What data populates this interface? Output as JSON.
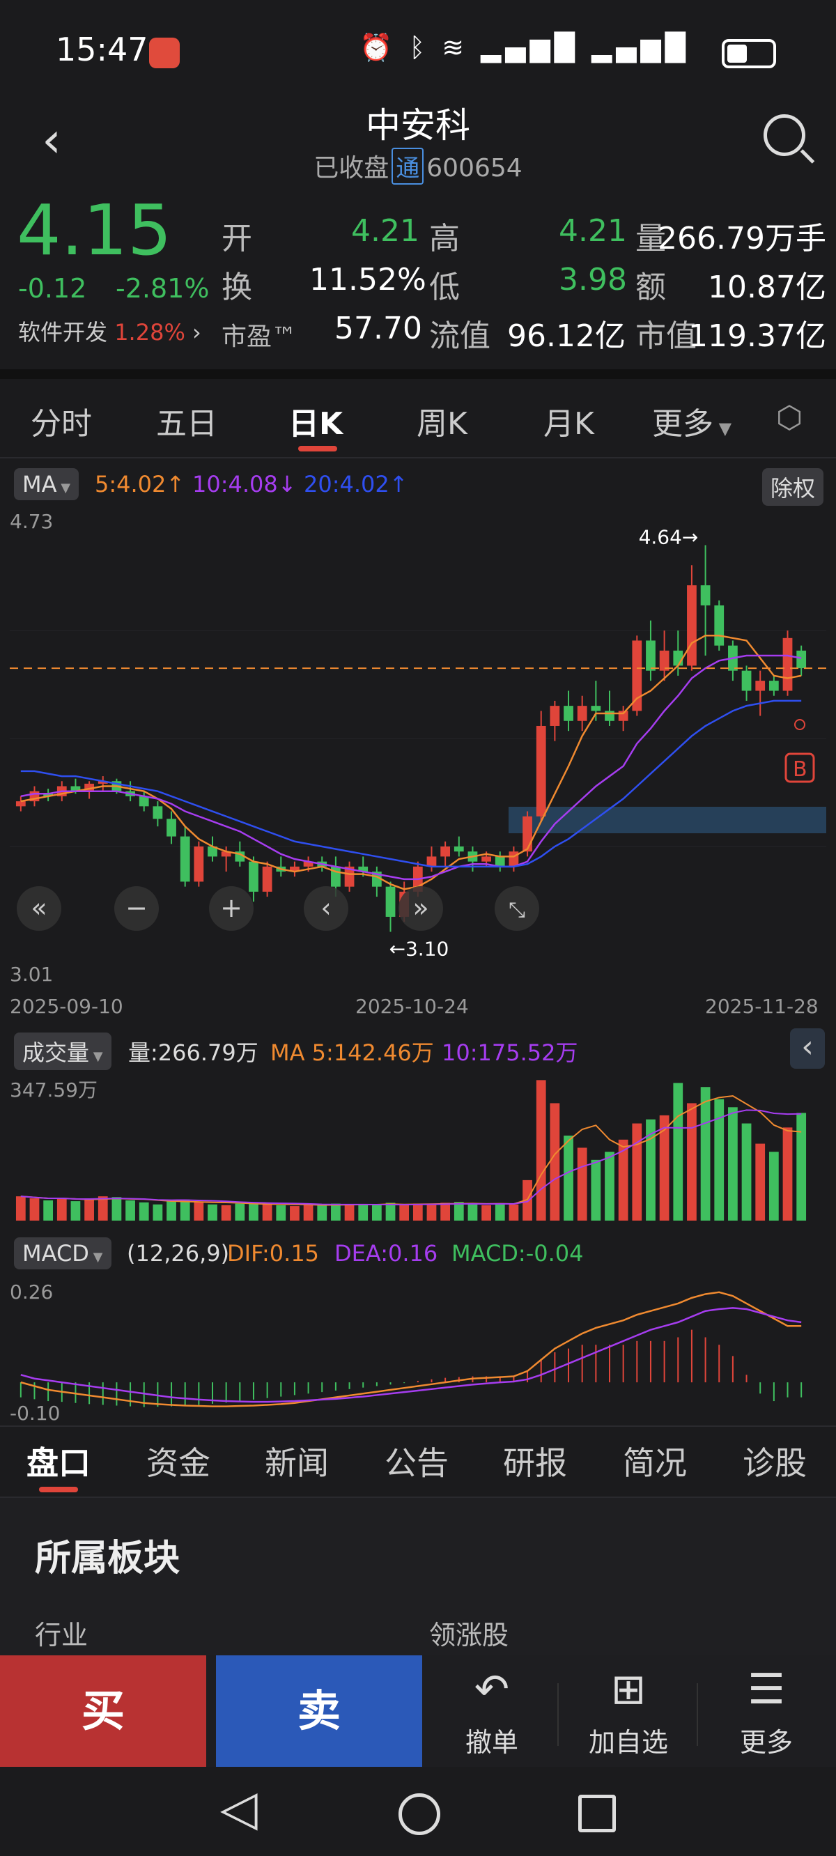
{
  "status": {
    "time": "15:47"
  },
  "header": {
    "title": "中安科",
    "status": "已收盘",
    "tong": "通",
    "code": "600654"
  },
  "quote": {
    "price": "4.15",
    "change": "-0.12",
    "change_pct": "-2.81%",
    "sector_name": "软件开发",
    "sector_pct": "1.28%",
    "open_label": "开",
    "open": "4.21",
    "high_label": "高",
    "high": "4.21",
    "volume_label": "量",
    "volume": "266.79万手",
    "turnover_label": "换",
    "turnover": "11.52%",
    "low_label": "低",
    "low": "3.98",
    "amount_label": "额",
    "amount": "10.87亿",
    "pe_label": "市盈™",
    "pe": "57.70",
    "float_label": "流值",
    "float_cap": "96.12亿",
    "mcap_label": "市值",
    "mcap": "119.37亿"
  },
  "tabs": [
    "分时",
    "五日",
    "日K",
    "周K",
    "月K",
    "更多"
  ],
  "ma_bar": {
    "ma_label": "MA",
    "ma5": "5:4.02↑",
    "ma10": "10:4.08↓",
    "ma20": "20:4.02↑",
    "adjust": "除权"
  },
  "colors": {
    "up": "#e0453a",
    "down": "#3fbf5f",
    "ma5": "#f08a30",
    "ma10": "#a63df0",
    "ma20": "#2f4ff0"
  },
  "chart_data": [
    {
      "type": "candlestick",
      "title": "日K",
      "y_top_label": "4.73",
      "y_bottom_label": "3.01",
      "ylim": [
        3.01,
        4.73
      ],
      "x_labels": [
        "2025-09-10",
        "2025-10-24",
        "2025-11-28"
      ],
      "max_marker": "4.64→",
      "min_marker": "←3.10",
      "current_price_line": 4.15,
      "candles": [
        [
          3.6,
          3.64,
          3.58,
          3.62
        ],
        [
          3.62,
          3.68,
          3.6,
          3.66
        ],
        [
          3.65,
          3.67,
          3.62,
          3.64
        ],
        [
          3.64,
          3.7,
          3.62,
          3.68
        ],
        [
          3.68,
          3.71,
          3.65,
          3.66
        ],
        [
          3.66,
          3.7,
          3.63,
          3.69
        ],
        [
          3.69,
          3.72,
          3.66,
          3.7
        ],
        [
          3.7,
          3.71,
          3.65,
          3.66
        ],
        [
          3.66,
          3.7,
          3.62,
          3.64
        ],
        [
          3.64,
          3.66,
          3.58,
          3.6
        ],
        [
          3.6,
          3.62,
          3.52,
          3.55
        ],
        [
          3.55,
          3.58,
          3.45,
          3.48
        ],
        [
          3.48,
          3.52,
          3.28,
          3.3
        ],
        [
          3.3,
          3.46,
          3.28,
          3.44
        ],
        [
          3.44,
          3.48,
          3.38,
          3.4
        ],
        [
          3.4,
          3.44,
          3.34,
          3.42
        ],
        [
          3.42,
          3.46,
          3.36,
          3.38
        ],
        [
          3.38,
          3.4,
          3.22,
          3.26
        ],
        [
          3.26,
          3.38,
          3.24,
          3.36
        ],
        [
          3.36,
          3.4,
          3.32,
          3.34
        ],
        [
          3.34,
          3.38,
          3.32,
          3.36
        ],
        [
          3.36,
          3.4,
          3.34,
          3.38
        ],
        [
          3.38,
          3.4,
          3.34,
          3.36
        ],
        [
          3.36,
          3.4,
          3.24,
          3.28
        ],
        [
          3.28,
          3.38,
          3.26,
          3.36
        ],
        [
          3.36,
          3.4,
          3.32,
          3.34
        ],
        [
          3.34,
          3.36,
          3.24,
          3.28
        ],
        [
          3.28,
          3.3,
          3.1,
          3.16
        ],
        [
          3.16,
          3.3,
          3.14,
          3.26
        ],
        [
          3.26,
          3.38,
          3.24,
          3.36
        ],
        [
          3.36,
          3.44,
          3.34,
          3.4
        ],
        [
          3.4,
          3.46,
          3.36,
          3.44
        ],
        [
          3.44,
          3.48,
          3.4,
          3.42
        ],
        [
          3.42,
          3.44,
          3.34,
          3.38
        ],
        [
          3.38,
          3.42,
          3.36,
          3.4
        ],
        [
          3.4,
          3.42,
          3.34,
          3.36
        ],
        [
          3.36,
          3.44,
          3.34,
          3.42
        ],
        [
          3.42,
          3.58,
          3.4,
          3.56
        ],
        [
          3.56,
          3.98,
          3.54,
          3.92
        ],
        [
          3.92,
          4.02,
          3.86,
          4.0
        ],
        [
          4.0,
          4.06,
          3.9,
          3.94
        ],
        [
          3.94,
          4.04,
          3.9,
          4.0
        ],
        [
          4.0,
          4.1,
          3.94,
          3.98
        ],
        [
          3.98,
          4.06,
          3.92,
          3.94
        ],
        [
          3.94,
          4.0,
          3.9,
          3.98
        ],
        [
          3.98,
          4.28,
          3.96,
          4.26
        ],
        [
          4.26,
          4.34,
          4.1,
          4.14
        ],
        [
          4.14,
          4.3,
          4.1,
          4.22
        ],
        [
          4.22,
          4.3,
          4.12,
          4.16
        ],
        [
          4.16,
          4.56,
          4.14,
          4.48
        ],
        [
          4.48,
          4.64,
          4.2,
          4.4
        ],
        [
          4.4,
          4.42,
          4.22,
          4.24
        ],
        [
          4.24,
          4.26,
          4.1,
          4.14
        ],
        [
          4.14,
          4.16,
          4.02,
          4.06
        ],
        [
          4.06,
          4.14,
          3.96,
          4.1
        ],
        [
          4.1,
          4.12,
          4.04,
          4.06
        ],
        [
          4.06,
          4.3,
          4.04,
          4.27
        ],
        [
          4.22,
          4.24,
          4.12,
          4.15
        ]
      ],
      "ma5": [
        3.62,
        3.63,
        3.64,
        3.65,
        3.66,
        3.67,
        3.68,
        3.68,
        3.67,
        3.66,
        3.63,
        3.59,
        3.52,
        3.47,
        3.44,
        3.42,
        3.41,
        3.38,
        3.37,
        3.35,
        3.34,
        3.35,
        3.36,
        3.34,
        3.33,
        3.33,
        3.32,
        3.29,
        3.27,
        3.28,
        3.31,
        3.35,
        3.39,
        3.4,
        3.41,
        3.4,
        3.4,
        3.43,
        3.54,
        3.65,
        3.76,
        3.88,
        3.97,
        3.97,
        3.97,
        4.03,
        4.06,
        4.11,
        4.16,
        4.25,
        4.28,
        4.28,
        4.27,
        4.26,
        4.19,
        4.12,
        4.11,
        4.12
      ],
      "ma10": [
        3.64,
        3.65,
        3.65,
        3.66,
        3.66,
        3.66,
        3.66,
        3.66,
        3.65,
        3.64,
        3.63,
        3.61,
        3.58,
        3.56,
        3.54,
        3.52,
        3.5,
        3.47,
        3.44,
        3.41,
        3.39,
        3.38,
        3.37,
        3.36,
        3.35,
        3.34,
        3.33,
        3.32,
        3.31,
        3.31,
        3.32,
        3.34,
        3.36,
        3.37,
        3.37,
        3.36,
        3.36,
        3.38,
        3.46,
        3.53,
        3.58,
        3.63,
        3.68,
        3.72,
        3.76,
        3.85,
        3.91,
        3.98,
        4.04,
        4.11,
        4.15,
        4.18,
        4.19,
        4.2,
        4.2,
        4.2,
        4.2,
        4.19
      ],
      "ma20": [
        3.74,
        3.74,
        3.73,
        3.72,
        3.72,
        3.71,
        3.7,
        3.69,
        3.68,
        3.67,
        3.66,
        3.64,
        3.62,
        3.6,
        3.58,
        3.56,
        3.54,
        3.52,
        3.5,
        3.48,
        3.46,
        3.45,
        3.44,
        3.43,
        3.42,
        3.41,
        3.4,
        3.39,
        3.38,
        3.37,
        3.36,
        3.36,
        3.36,
        3.36,
        3.36,
        3.36,
        3.36,
        3.37,
        3.4,
        3.44,
        3.47,
        3.51,
        3.55,
        3.59,
        3.63,
        3.68,
        3.73,
        3.78,
        3.83,
        3.88,
        3.92,
        3.95,
        3.98,
        4.0,
        4.01,
        4.02,
        4.02,
        4.02
      ]
    },
    {
      "type": "bar",
      "title": "成交量",
      "y_top_label": "347.59万",
      "ylim": [
        0,
        347.59
      ],
      "values": [
        60,
        55,
        50,
        55,
        48,
        52,
        60,
        58,
        50,
        45,
        40,
        48,
        52,
        46,
        40,
        38,
        42,
        44,
        40,
        38,
        36,
        40,
        38,
        42,
        40,
        38,
        40,
        44,
        38,
        42,
        40,
        44,
        46,
        40,
        38,
        42,
        40,
        100,
        347,
        290,
        210,
        180,
        150,
        170,
        200,
        240,
        250,
        260,
        340,
        290,
        330,
        300,
        280,
        240,
        190,
        170,
        230,
        266
      ]
    },
    {
      "type": "bar",
      "title": "MACD",
      "y_top_label": "0.26",
      "y_bottom_label": "-0.10",
      "ylim": [
        -0.1,
        0.26
      ],
      "values": [
        -0.04,
        -0.045,
        -0.05,
        -0.052,
        -0.055,
        -0.058,
        -0.06,
        -0.062,
        -0.064,
        -0.066,
        -0.065,
        -0.064,
        -0.062,
        -0.06,
        -0.057,
        -0.054,
        -0.05,
        -0.046,
        -0.042,
        -0.038,
        -0.034,
        -0.03,
        -0.026,
        -0.022,
        -0.018,
        -0.014,
        -0.01,
        -0.006,
        -0.002,
        0.004,
        0.008,
        0.012,
        0.014,
        0.016,
        0.016,
        0.016,
        0.016,
        0.03,
        0.06,
        0.08,
        0.09,
        0.1,
        0.1,
        0.1,
        0.1,
        0.11,
        0.11,
        0.11,
        0.12,
        0.14,
        0.12,
        0.1,
        0.07,
        0.02,
        -0.03,
        -0.05,
        -0.04,
        -0.04
      ],
      "dif": [
        0.0,
        -0.01,
        -0.02,
        -0.025,
        -0.03,
        -0.035,
        -0.04,
        -0.045,
        -0.05,
        -0.055,
        -0.058,
        -0.06,
        -0.062,
        -0.063,
        -0.064,
        -0.064,
        -0.063,
        -0.062,
        -0.06,
        -0.058,
        -0.055,
        -0.05,
        -0.045,
        -0.04,
        -0.035,
        -0.03,
        -0.025,
        -0.02,
        -0.015,
        -0.01,
        -0.005,
        0.0,
        0.005,
        0.01,
        0.012,
        0.014,
        0.016,
        0.03,
        0.06,
        0.09,
        0.11,
        0.13,
        0.145,
        0.155,
        0.165,
        0.18,
        0.19,
        0.2,
        0.21,
        0.225,
        0.235,
        0.24,
        0.23,
        0.21,
        0.19,
        0.17,
        0.15,
        0.15
      ],
      "dea": [
        0.02,
        0.01,
        0.005,
        0.0,
        -0.005,
        -0.01,
        -0.015,
        -0.02,
        -0.025,
        -0.03,
        -0.035,
        -0.04,
        -0.043,
        -0.046,
        -0.048,
        -0.05,
        -0.051,
        -0.052,
        -0.052,
        -0.051,
        -0.05,
        -0.048,
        -0.046,
        -0.044,
        -0.041,
        -0.038,
        -0.034,
        -0.03,
        -0.026,
        -0.022,
        -0.018,
        -0.014,
        -0.01,
        -0.006,
        -0.003,
        0.0,
        0.002,
        0.008,
        0.02,
        0.035,
        0.05,
        0.065,
        0.08,
        0.095,
        0.11,
        0.125,
        0.14,
        0.15,
        0.16,
        0.175,
        0.19,
        0.195,
        0.198,
        0.195,
        0.185,
        0.175,
        0.165,
        0.16
      ]
    }
  ],
  "volume_bar": {
    "label": "成交量",
    "vol": "量:266.79万",
    "ma5": "MA 5:142.46万",
    "ma10": "10:175.52万"
  },
  "macd_bar": {
    "label": "MACD",
    "params": "(12,26,9)",
    "dif": "DIF:0.15",
    "dea": "DEA:0.16",
    "macd": "MACD:-0.04"
  },
  "section_tabs": [
    "盘口",
    "资金",
    "新闻",
    "公告",
    "研报",
    "简况",
    "诊股"
  ],
  "sector_panel": {
    "title": "所属板块",
    "industry_label": "行业",
    "leader_label": "领涨股"
  },
  "bottom": {
    "buy": "买",
    "sell": "卖",
    "cancel": "撤单",
    "add_watch": "加自选",
    "more": "更多"
  }
}
